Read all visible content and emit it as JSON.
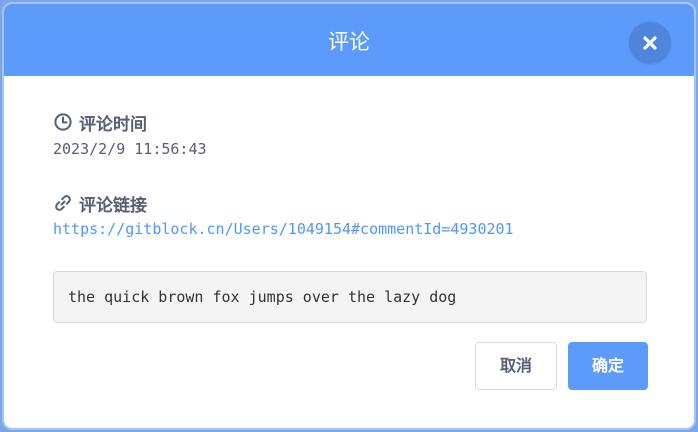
{
  "dialog": {
    "title": "评论",
    "close_icon": "close-icon"
  },
  "comment_time": {
    "label": "评论时间",
    "icon": "clock-icon",
    "value": "2023/2/9 11:56:43"
  },
  "comment_link": {
    "label": "评论链接",
    "icon": "link-icon",
    "value": "https://gitblock.cn/Users/1049154#commentId=4930201"
  },
  "comment": {
    "text": "the quick brown fox jumps over the lazy dog"
  },
  "buttons": {
    "cancel_label": "取消",
    "confirm_label": "确定"
  },
  "colors": {
    "header": "#5c9bfb",
    "close_button": "#4e86dc",
    "link": "#4c97ff",
    "text": "#575e75",
    "confirm_button": "#5c9bfb"
  }
}
